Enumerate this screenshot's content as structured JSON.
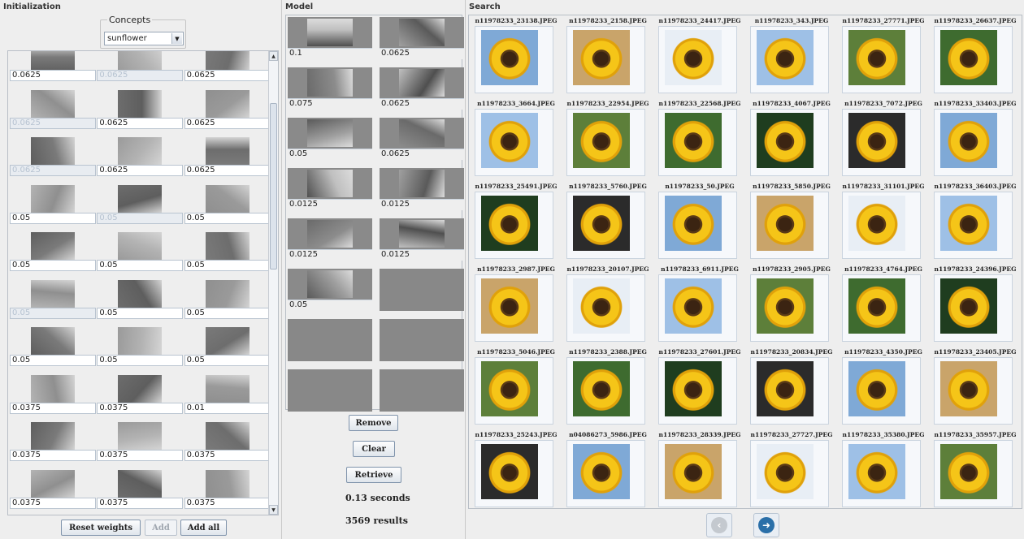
{
  "init": {
    "title": "Initialization",
    "concepts_label": "Concepts",
    "concept_selected": "sunflower",
    "tiles": [
      [
        {
          "w": "0.0625"
        },
        {
          "w": "0.0625",
          "dim": true
        },
        {
          "w": "0.0625"
        }
      ],
      [
        {
          "w": "0.0625",
          "dim": true
        },
        {
          "w": "0.0625"
        },
        {
          "w": "0.0625"
        }
      ],
      [
        {
          "w": "0.0625",
          "dim": true
        },
        {
          "w": "0.0625"
        },
        {
          "w": "0.0625"
        }
      ],
      [
        {
          "w": "0.05"
        },
        {
          "w": "0.05",
          "dim": true
        },
        {
          "w": "0.05"
        }
      ],
      [
        {
          "w": "0.05"
        },
        {
          "w": "0.05"
        },
        {
          "w": "0.05"
        }
      ],
      [
        {
          "w": "0.05",
          "dim": true
        },
        {
          "w": "0.05"
        },
        {
          "w": "0.05"
        }
      ],
      [
        {
          "w": "0.05"
        },
        {
          "w": "0.05"
        },
        {
          "w": "0.05"
        }
      ],
      [
        {
          "w": "0.0375"
        },
        {
          "w": "0.0375"
        },
        {
          "w": "0.01"
        }
      ],
      [
        {
          "w": "0.0375"
        },
        {
          "w": "0.0375"
        },
        {
          "w": "0.0375"
        }
      ],
      [
        {
          "w": "0.0375"
        },
        {
          "w": "0.0375"
        },
        {
          "w": "0.0375"
        }
      ]
    ],
    "buttons": {
      "reset": "Reset weights",
      "add": "Add",
      "add_all": "Add all"
    }
  },
  "model": {
    "title": "Model",
    "tiles": [
      "0.1",
      "0.0625",
      "0.075",
      "0.0625",
      "0.05",
      "0.0625",
      "0.0125",
      "0.0125",
      "0.0125",
      "0.0125",
      "0.05",
      "",
      "",
      "",
      "",
      ""
    ],
    "buttons": {
      "remove": "Remove",
      "clear": "Clear",
      "retrieve": "Retrieve"
    },
    "time_text": "0.13 seconds",
    "results_text": "3569 results"
  },
  "search": {
    "title": "Search",
    "results": [
      "n11978233_23138.JPEG",
      "n11978233_2158.JPEG",
      "n11978233_24417.JPEG",
      "n11978233_343.JPEG",
      "n11978233_27771.JPEG",
      "n11978233_26637.JPEG",
      "n11978233_3664.JPEG",
      "n11978233_22954.JPEG",
      "n11978233_22568.JPEG",
      "n11978233_4067.JPEG",
      "n11978233_7072.JPEG",
      "n11978233_33403.JPEG",
      "n11978233_25491.JPEG",
      "n11978233_5760.JPEG",
      "n11978233_50.JPEG",
      "n11978233_5850.JPEG",
      "n11978233_31101.JPEG",
      "n11978233_36403.JPEG",
      "n11978233_2987.JPEG",
      "n11978233_20107.JPEG",
      "n11978233_6911.JPEG",
      "n11978233_2905.JPEG",
      "n11978233_4764.JPEG",
      "n11978233_24396.JPEG",
      "n11978233_5046.JPEG",
      "n11978233_2388.JPEG",
      "n11978233_27601.JPEG",
      "n11978233_20834.JPEG",
      "n11978233_4350.JPEG",
      "n11978233_23405.JPEG",
      "n11978233_25243.JPEG",
      "n04086273_5986.JPEG",
      "n11978233_28339.JPEG",
      "n11978233_27727.JPEG",
      "n11978233_35380.JPEG",
      "n11978233_35957.JPEG"
    ],
    "nav": {
      "prev": "previous-page",
      "next": "next-page"
    },
    "colors": {
      "next": "#2a6fa8",
      "prev": "#c4c9cf"
    }
  }
}
